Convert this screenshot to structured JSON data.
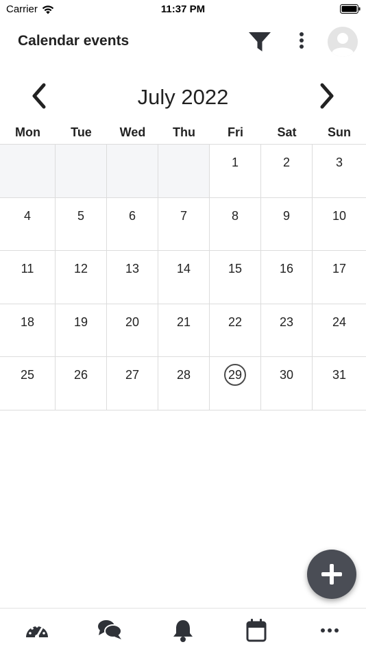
{
  "status_bar": {
    "carrier": "Carrier",
    "time": "11:37 PM"
  },
  "header": {
    "title": "Calendar events",
    "icons": [
      "filter-icon",
      "more-vertical-icon",
      "avatar-placeholder-icon"
    ]
  },
  "calendar": {
    "month_title": "July 2022",
    "weekdays": [
      "Mon",
      "Tue",
      "Wed",
      "Thu",
      "Fri",
      "Sat",
      "Sun"
    ],
    "weeks": [
      [
        "",
        "",
        "",
        "",
        "1",
        "2",
        "3"
      ],
      [
        "4",
        "5",
        "6",
        "7",
        "8",
        "9",
        "10"
      ],
      [
        "11",
        "12",
        "13",
        "14",
        "15",
        "16",
        "17"
      ],
      [
        "18",
        "19",
        "20",
        "21",
        "22",
        "23",
        "24"
      ],
      [
        "25",
        "26",
        "27",
        "28",
        "29",
        "30",
        "31"
      ]
    ],
    "today": "29"
  },
  "tabs": [
    "dashboard-icon",
    "chat-icon",
    "bell-icon",
    "calendar-icon",
    "more-horizontal-icon"
  ],
  "colors": {
    "fab": "#4a4d55",
    "grid_line": "#dcdcdc",
    "empty_cell": "#f5f6f8",
    "icon": "#2f3238"
  }
}
